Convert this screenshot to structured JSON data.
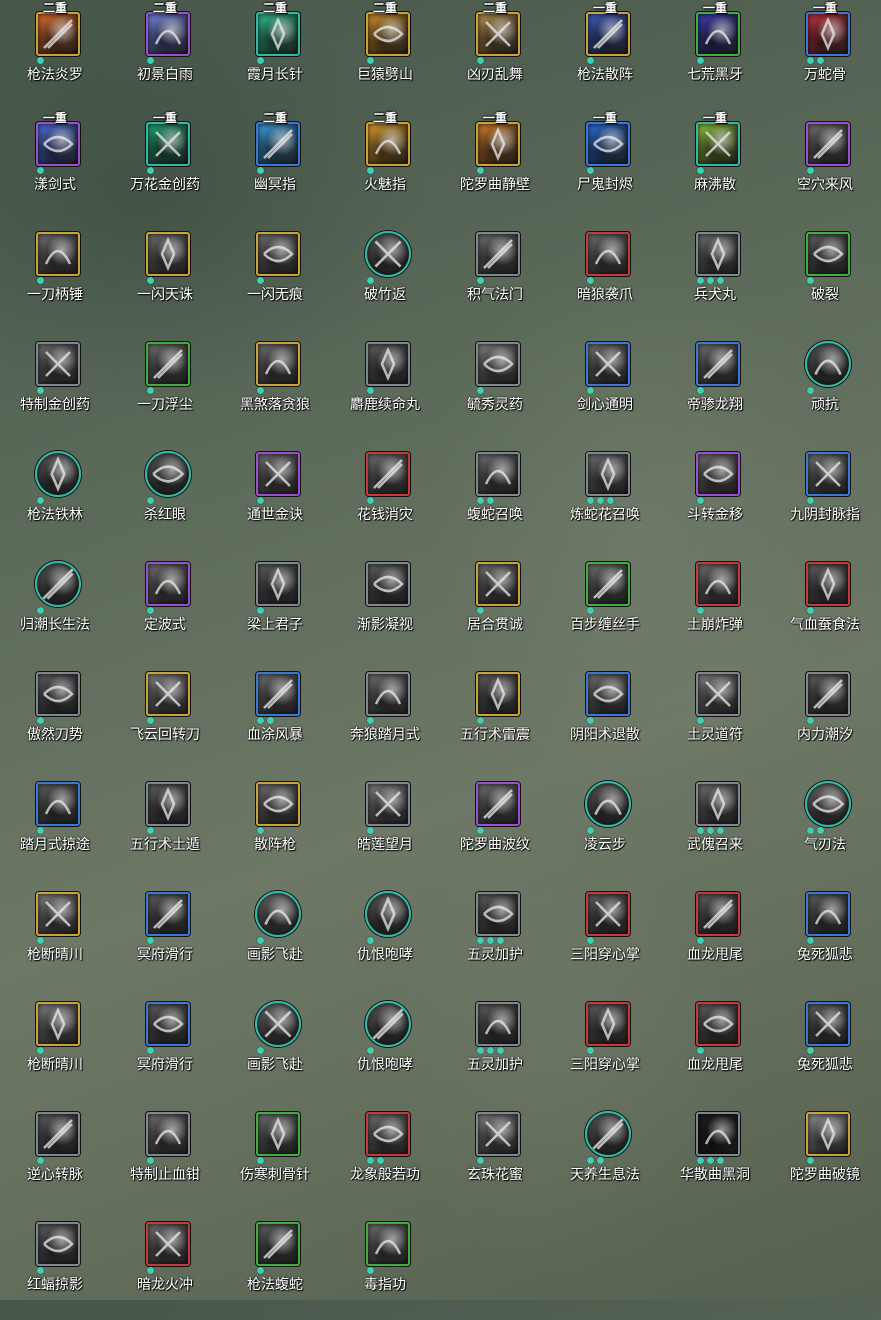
{
  "skills": [
    {
      "name": "枪法炎罗",
      "badge": "二重",
      "border": "gold",
      "round": false,
      "dots": 1,
      "tone": "#d86a2a"
    },
    {
      "name": "初景白雨",
      "badge": "二重",
      "border": "purple",
      "round": false,
      "dots": 1,
      "tone": "#6f7fd8"
    },
    {
      "name": "霞月长针",
      "badge": "二重",
      "border": "teal",
      "round": false,
      "dots": 1,
      "tone": "#2fb88a"
    },
    {
      "name": "巨猿劈山",
      "badge": "二重",
      "border": "gold",
      "round": false,
      "dots": 1,
      "tone": "#c98a2a"
    },
    {
      "name": "凶刃乱舞",
      "badge": "二重",
      "border": "gold",
      "round": false,
      "dots": 1,
      "tone": "#b08a4a"
    },
    {
      "name": "枪法散阵",
      "badge": "一重",
      "border": "gold",
      "round": false,
      "dots": 1,
      "tone": "#3a5ab8"
    },
    {
      "name": "七荒黑牙",
      "badge": "一重",
      "border": "green",
      "round": false,
      "dots": 1,
      "tone": "#3a3aa8"
    },
    {
      "name": "万蛇骨",
      "badge": "一重",
      "border": "blue",
      "round": false,
      "dots": 2,
      "tone": "#b8303a"
    },
    {
      "name": "漾剑式",
      "badge": "一重",
      "border": "purple",
      "round": false,
      "dots": 1,
      "tone": "#4a6ad0"
    },
    {
      "name": "万花金创药",
      "badge": "一重",
      "border": "teal",
      "round": false,
      "dots": 1,
      "tone": "#20a070"
    },
    {
      "name": "幽冥指",
      "badge": "二重",
      "border": "blue",
      "round": false,
      "dots": 1,
      "tone": "#3a9ad8"
    },
    {
      "name": "火魅指",
      "badge": "二重",
      "border": "gold",
      "round": false,
      "dots": 1,
      "tone": "#d8982a"
    },
    {
      "name": "陀罗曲静壁",
      "badge": "一重",
      "border": "gold",
      "round": false,
      "dots": 1,
      "tone": "#c8782a"
    },
    {
      "name": "尸鬼封烬",
      "badge": "一重",
      "border": "blue",
      "round": false,
      "dots": 1,
      "tone": "#2a6ad0"
    },
    {
      "name": "麻沸散",
      "badge": "一重",
      "border": "teal",
      "round": false,
      "dots": 1,
      "tone": "#8ab83a"
    },
    {
      "name": "空穴来风",
      "badge": "",
      "border": "purple",
      "round": false,
      "dots": 1,
      "tone": "#6a6a6a"
    },
    {
      "name": "一刀柄锤",
      "badge": "",
      "border": "gold",
      "round": false,
      "dots": 1,
      "tone": "#6a6a6a"
    },
    {
      "name": "一闪天诛",
      "badge": "",
      "border": "gold",
      "round": false,
      "dots": 1,
      "tone": "#6a6a6a"
    },
    {
      "name": "一闪无痕",
      "badge": "",
      "border": "gold",
      "round": false,
      "dots": 1,
      "tone": "#6a6a6a"
    },
    {
      "name": "破竹返",
      "badge": "",
      "border": "teal",
      "round": true,
      "dots": 1,
      "tone": "#5a5a5a"
    },
    {
      "name": "积气法门",
      "badge": "",
      "border": "gray",
      "round": false,
      "dots": 1,
      "tone": "#6a6a6a"
    },
    {
      "name": "暗狼袭爪",
      "badge": "",
      "border": "red",
      "round": false,
      "dots": 1,
      "tone": "#6a6a6a"
    },
    {
      "name": "兵犬丸",
      "badge": "",
      "border": "gray",
      "round": false,
      "dots": 3,
      "tone": "#6a6a6a"
    },
    {
      "name": "破裂",
      "badge": "",
      "border": "green",
      "round": false,
      "dots": 1,
      "tone": "#5a5a5a"
    },
    {
      "name": "特制金创药",
      "badge": "",
      "border": "gray",
      "round": false,
      "dots": 1,
      "tone": "#6a6a6a"
    },
    {
      "name": "一刀浮尘",
      "badge": "",
      "border": "green",
      "round": false,
      "dots": 1,
      "tone": "#6a6a6a"
    },
    {
      "name": "黑煞落贪狼",
      "badge": "",
      "border": "gold",
      "round": false,
      "dots": 1,
      "tone": "#6a6a6a"
    },
    {
      "name": "麝鹿续命丸",
      "badge": "",
      "border": "gray",
      "round": false,
      "dots": 1,
      "tone": "#5a5a5a"
    },
    {
      "name": "毓秀灵药",
      "badge": "",
      "border": "gray",
      "round": false,
      "dots": 1,
      "tone": "#7a7a7a"
    },
    {
      "name": "剑心通明",
      "badge": "",
      "border": "blue",
      "round": false,
      "dots": 1,
      "tone": "#6a6a6a"
    },
    {
      "name": "帝骖龙翔",
      "badge": "",
      "border": "blue",
      "round": false,
      "dots": 1,
      "tone": "#6a6a6a"
    },
    {
      "name": "顽抗",
      "badge": "",
      "border": "teal",
      "round": true,
      "dots": 1,
      "tone": "#5a5a5a"
    },
    {
      "name": "枪法铁林",
      "badge": "",
      "border": "teal",
      "round": true,
      "dots": 1,
      "tone": "#5a5a5a"
    },
    {
      "name": "杀红眼",
      "badge": "",
      "border": "teal",
      "round": true,
      "dots": 1,
      "tone": "#5a5a5a"
    },
    {
      "name": "通世金诀",
      "badge": "",
      "border": "purple",
      "round": false,
      "dots": 1,
      "tone": "#6a6a6a"
    },
    {
      "name": "花钱消灾",
      "badge": "",
      "border": "red",
      "round": false,
      "dots": 1,
      "tone": "#6a6a6a"
    },
    {
      "name": "蝮蛇召唤",
      "badge": "",
      "border": "gray",
      "round": false,
      "dots": 2,
      "tone": "#6a6a6a"
    },
    {
      "name": "炼蛇花召唤",
      "badge": "",
      "border": "gray",
      "round": false,
      "dots": 3,
      "tone": "#6a6a6a"
    },
    {
      "name": "斗转金移",
      "badge": "",
      "border": "purple",
      "round": false,
      "dots": 1,
      "tone": "#6a6a6a"
    },
    {
      "name": "九阴封脉指",
      "badge": "",
      "border": "blue",
      "round": false,
      "dots": 1,
      "tone": "#6a6a6a"
    },
    {
      "name": "归潮长生法",
      "badge": "",
      "border": "teal",
      "round": true,
      "dots": 1,
      "tone": "#5a5a5a"
    },
    {
      "name": "定波式",
      "badge": "",
      "border": "purple",
      "round": false,
      "dots": 1,
      "tone": "#6a6a6a"
    },
    {
      "name": "梁上君子",
      "badge": "",
      "border": "gray",
      "round": false,
      "dots": 1,
      "tone": "#5a5a5a"
    },
    {
      "name": "渐影凝视",
      "badge": "",
      "border": "gray",
      "round": false,
      "dots": 0,
      "tone": "#5a5a5a"
    },
    {
      "name": "居合贯诚",
      "badge": "",
      "border": "gold",
      "round": false,
      "dots": 1,
      "tone": "#6a6a6a"
    },
    {
      "name": "百步缠丝手",
      "badge": "",
      "border": "green",
      "round": false,
      "dots": 1,
      "tone": "#6a6a6a"
    },
    {
      "name": "土崩炸弹",
      "badge": "",
      "border": "red",
      "round": false,
      "dots": 1,
      "tone": "#6a6a6a"
    },
    {
      "name": "气血蚕食法",
      "badge": "",
      "border": "red",
      "round": false,
      "dots": 1,
      "tone": "#5a5a5a"
    },
    {
      "name": "傲然刀势",
      "badge": "",
      "border": "gray",
      "round": false,
      "dots": 1,
      "tone": "#5a5a5a"
    },
    {
      "name": "飞云回转刀",
      "badge": "",
      "border": "gold",
      "round": false,
      "dots": 1,
      "tone": "#7a7a7a"
    },
    {
      "name": "血涂风暴",
      "badge": "",
      "border": "blue",
      "round": false,
      "dots": 2,
      "tone": "#6a6a6a"
    },
    {
      "name": "奔狼踏月式",
      "badge": "",
      "border": "gray",
      "round": false,
      "dots": 1,
      "tone": "#6a6a6a"
    },
    {
      "name": "五行术雷震",
      "badge": "",
      "border": "gold",
      "round": false,
      "dots": 1,
      "tone": "#5a5a5a"
    },
    {
      "name": "阴阳术退散",
      "badge": "",
      "border": "blue",
      "round": false,
      "dots": 1,
      "tone": "#6a6a6a"
    },
    {
      "name": "土灵道符",
      "badge": "",
      "border": "gray",
      "round": false,
      "dots": 1,
      "tone": "#7a7a7a"
    },
    {
      "name": "内力潮汐",
      "badge": "",
      "border": "gray",
      "round": false,
      "dots": 1,
      "tone": "#5a5a5a"
    },
    {
      "name": "踏月式掠途",
      "badge": "",
      "border": "blue",
      "round": false,
      "dots": 1,
      "tone": "#5a5a5a"
    },
    {
      "name": "五行术土遁",
      "badge": "",
      "border": "gray",
      "round": false,
      "dots": 1,
      "tone": "#5a5a5a"
    },
    {
      "name": "散阵枪",
      "badge": "",
      "border": "gold",
      "round": false,
      "dots": 1,
      "tone": "#6a6a6a"
    },
    {
      "name": "皓莲望月",
      "badge": "",
      "border": "gray",
      "round": false,
      "dots": 1,
      "tone": "#7a7a7a"
    },
    {
      "name": "陀罗曲波纹",
      "badge": "",
      "border": "purple",
      "round": false,
      "dots": 1,
      "tone": "#6a6a6a"
    },
    {
      "name": "凌云步",
      "badge": "",
      "border": "teal",
      "round": true,
      "dots": 1,
      "tone": "#5a5a5a"
    },
    {
      "name": "武傀召来",
      "badge": "",
      "border": "gray",
      "round": false,
      "dots": 3,
      "tone": "#6a6a6a"
    },
    {
      "name": "气刃法",
      "badge": "",
      "border": "teal",
      "round": true,
      "dots": 2,
      "tone": "#6a6a6a"
    },
    {
      "name": "枪断晴川",
      "badge": "",
      "border": "gold",
      "round": false,
      "dots": 1,
      "tone": "#7a7a7a"
    },
    {
      "name": "冥府滑行",
      "badge": "",
      "border": "blue",
      "round": false,
      "dots": 1,
      "tone": "#5a5a5a"
    },
    {
      "name": "画影飞赴",
      "badge": "",
      "border": "teal",
      "round": true,
      "dots": 1,
      "tone": "#6a6a6a"
    },
    {
      "name": "仇恨咆哮",
      "badge": "",
      "border": "teal",
      "round": true,
      "dots": 1,
      "tone": "#5a5a5a"
    },
    {
      "name": "五灵加护",
      "badge": "",
      "border": "gray",
      "round": false,
      "dots": 3,
      "tone": "#5a5a5a"
    },
    {
      "name": "三阳穿心掌",
      "badge": "",
      "border": "red",
      "round": false,
      "dots": 1,
      "tone": "#5a5a5a"
    },
    {
      "name": "血龙甩尾",
      "badge": "",
      "border": "red",
      "round": false,
      "dots": 1,
      "tone": "#5a5a5a"
    },
    {
      "name": "兔死狐悲",
      "badge": "",
      "border": "blue",
      "round": false,
      "dots": 1,
      "tone": "#5a5a5a"
    },
    {
      "name": "枪断晴川",
      "badge": "",
      "border": "gold",
      "round": false,
      "dots": 1,
      "tone": "#7a7a7a"
    },
    {
      "name": "冥府滑行",
      "badge": "",
      "border": "blue",
      "round": false,
      "dots": 1,
      "tone": "#5a5a5a"
    },
    {
      "name": "画影飞赴",
      "badge": "",
      "border": "teal",
      "round": true,
      "dots": 1,
      "tone": "#6a6a6a"
    },
    {
      "name": "仇恨咆哮",
      "badge": "",
      "border": "teal",
      "round": true,
      "dots": 1,
      "tone": "#5a5a5a"
    },
    {
      "name": "五灵加护",
      "badge": "",
      "border": "gray",
      "round": false,
      "dots": 3,
      "tone": "#5a5a5a"
    },
    {
      "name": "三阳穿心掌",
      "badge": "",
      "border": "red",
      "round": false,
      "dots": 1,
      "tone": "#5a5a5a"
    },
    {
      "name": "血龙甩尾",
      "badge": "",
      "border": "red",
      "round": false,
      "dots": 1,
      "tone": "#5a5a5a"
    },
    {
      "name": "兔死狐悲",
      "badge": "",
      "border": "blue",
      "round": false,
      "dots": 1,
      "tone": "#5a5a5a"
    },
    {
      "name": "逆心转脉",
      "badge": "",
      "border": "gray",
      "round": false,
      "dots": 1,
      "tone": "#5a5a5a"
    },
    {
      "name": "特制止血钳",
      "badge": "",
      "border": "gray",
      "round": false,
      "dots": 1,
      "tone": "#6a6a6a"
    },
    {
      "name": "伤寒刺骨针",
      "badge": "",
      "border": "green",
      "round": false,
      "dots": 1,
      "tone": "#6a6a6a"
    },
    {
      "name": "龙象般若功",
      "badge": "",
      "border": "red",
      "round": false,
      "dots": 2,
      "tone": "#6a6a6a"
    },
    {
      "name": "玄珠花蜜",
      "badge": "",
      "border": "gray",
      "round": false,
      "dots": 1,
      "tone": "#7a7a7a"
    },
    {
      "name": "天养生息法",
      "badge": "",
      "border": "teal",
      "round": true,
      "dots": 2,
      "tone": "#5a5a5a"
    },
    {
      "name": "华散曲黑洞",
      "badge": "",
      "border": "gray",
      "round": false,
      "dots": 3,
      "tone": "#1a1a1a"
    },
    {
      "name": "陀罗曲破镜",
      "badge": "",
      "border": "gold",
      "round": false,
      "dots": 1,
      "tone": "#8a8a8a"
    },
    {
      "name": "红蝠掠影",
      "badge": "",
      "border": "gray",
      "round": false,
      "dots": 1,
      "tone": "#5a5a5a"
    },
    {
      "name": "暗龙火冲",
      "badge": "",
      "border": "red",
      "round": false,
      "dots": 1,
      "tone": "#6a6a6a"
    },
    {
      "name": "枪法蝮蛇",
      "badge": "",
      "border": "green",
      "round": false,
      "dots": 1,
      "tone": "#5a5a5a"
    },
    {
      "name": "毒指功",
      "badge": "",
      "border": "green",
      "round": false,
      "dots": 1,
      "tone": "#6a6a6a"
    }
  ]
}
